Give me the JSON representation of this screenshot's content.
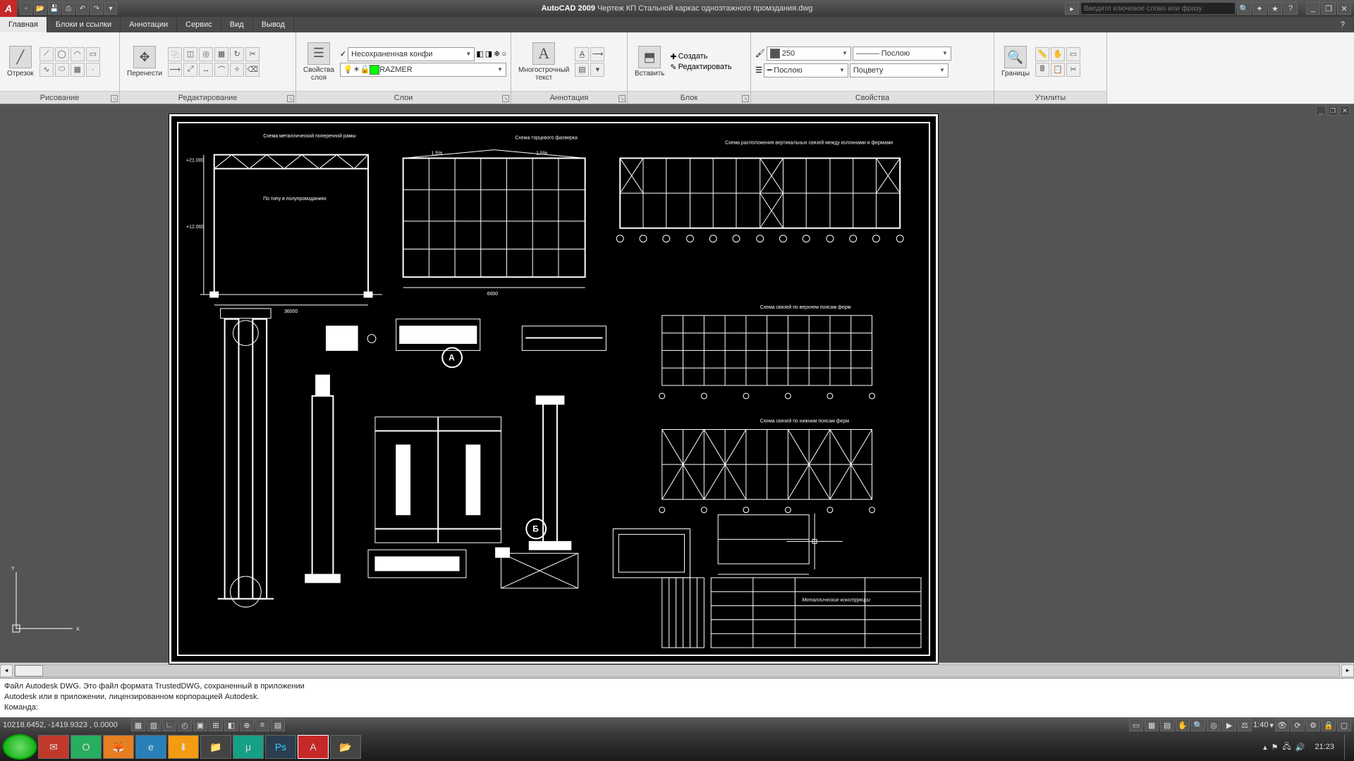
{
  "app": {
    "name": "AutoCAD 2009",
    "document": "Чертеж КП Стальной каркас одноэтажного промздания.dwg",
    "search_placeholder": "Введите ключевое слово или фразу"
  },
  "menu": {
    "tabs": [
      "Главная",
      "Блоки и ссылки",
      "Аннотации",
      "Сервис",
      "Вид",
      "Вывод"
    ],
    "active": 0
  },
  "ribbon": {
    "panels": [
      {
        "label": "Рисование",
        "big": {
          "label": "Отрезок"
        }
      },
      {
        "label": "Редактирование",
        "big": {
          "label": "Перенести"
        }
      },
      {
        "label": "Слои",
        "big": {
          "label": "Свойства\nслоя"
        },
        "dd1": "Несохраненная конфи",
        "dd2": "RAZMER"
      },
      {
        "label": "Аннотация",
        "big": {
          "label": "Многострочный\nтекст"
        }
      },
      {
        "label": "Блок",
        "big": {
          "label": "Вставить"
        },
        "btn1": "Создать",
        "btn2": "Редактировать"
      },
      {
        "label": "Свойства",
        "color": "250",
        "ltype": "Послою",
        "lweight": "Послою",
        "plot": "Поцвету"
      },
      {
        "label": "Утилиты",
        "big": {
          "label": "Границы"
        }
      }
    ]
  },
  "drawing": {
    "titles": {
      "t1": "Схема металлической поперечной рамы",
      "t2": "Схема торцевого фахверка",
      "t3": "Схема расположения вертикальных связей между колоннами и фермами",
      "t4": "Схема связей по верхнем поясам ферм",
      "t5": "Схема связей по нижним поясам ферм"
    },
    "markers": {
      "a": "А",
      "b": "Б"
    },
    "slope": "1,5%"
  },
  "cmd": {
    "line1": "Файл Autodesk DWG. Это файл формата TrustedDWG, сохраненный в приложении",
    "line2": "Autodesk или в приложении, лицензированном корпорацией Autodesk.",
    "prompt": "Команда:"
  },
  "status": {
    "coords": "10218.6452, -1419.9323 , 0.0000",
    "scale": "1:40",
    "time": "21:23"
  }
}
